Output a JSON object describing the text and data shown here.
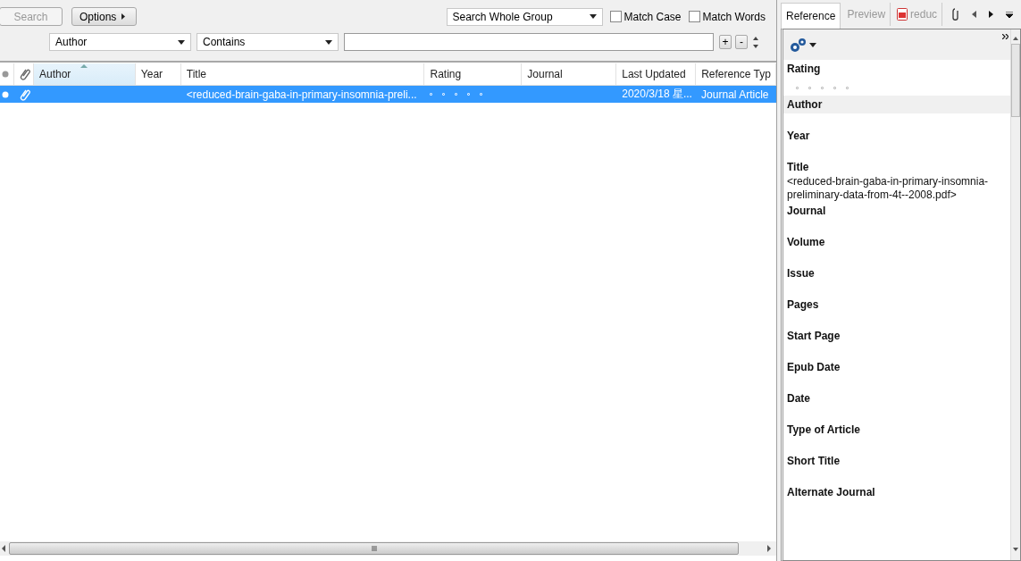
{
  "search_bar": {
    "search_button": {
      "label": "Search",
      "disabled": true
    },
    "options_button": "Options",
    "scope": "Search Whole Group",
    "match_case": {
      "label": "Match Case",
      "checked": false
    },
    "match_words": {
      "label": "Match Words",
      "checked": false
    },
    "criteria": [
      {
        "field": "Author",
        "operator": "Contains"
      }
    ],
    "add_button": "+",
    "remove_button": "-"
  },
  "table": {
    "columns": [
      {
        "label": "Author",
        "sorted": true
      },
      {
        "label": "Year",
        "sorted": false
      },
      {
        "label": "Title",
        "sorted": false
      },
      {
        "label": "Rating",
        "sorted": false
      },
      {
        "label": "Journal",
        "sorted": false
      },
      {
        "label": "Last Updated",
        "sorted": false
      },
      {
        "label": "Reference Typ",
        "sorted": false
      }
    ],
    "rows": [
      {
        "selected": true,
        "attachment": true,
        "title": "<reduced-brain-gaba-in-primary-insomnia-preli...",
        "stars": 0,
        "last_updated": "2020/3/18 星...",
        "reference_type": "Journal Article"
      }
    ]
  },
  "panel": {
    "tabs": [
      {
        "label": "Reference",
        "selected": true,
        "kind": "text"
      },
      {
        "label": "Preview",
        "selected": false,
        "kind": "text"
      },
      {
        "label": "reduc",
        "selected": false,
        "kind": "pdf"
      }
    ],
    "fields": [
      {
        "label": "Rating",
        "kind": "rating",
        "stars": 0,
        "selected": false
      },
      {
        "label": "Author",
        "kind": "text",
        "selected": true
      },
      {
        "label": "Year",
        "kind": "text",
        "selected": false
      },
      {
        "label": "Title",
        "kind": "text",
        "value": "<reduced-brain-gaba-in-primary-insomnia-preliminary-data-from-4t--2008.pdf>",
        "selected": false
      },
      {
        "label": "Journal",
        "kind": "text",
        "selected": false
      },
      {
        "label": "Volume",
        "kind": "text",
        "selected": false
      },
      {
        "label": "Issue",
        "kind": "text",
        "selected": false
      },
      {
        "label": "Pages",
        "kind": "text",
        "selected": false
      },
      {
        "label": "Start Page",
        "kind": "text",
        "selected": false
      },
      {
        "label": "Epub Date",
        "kind": "text",
        "selected": false
      },
      {
        "label": "Date",
        "kind": "text",
        "selected": false
      },
      {
        "label": "Type of Article",
        "kind": "text",
        "selected": false
      },
      {
        "label": "Short Title",
        "kind": "text",
        "selected": false
      },
      {
        "label": "Alternate Journal",
        "kind": "text",
        "selected": false
      }
    ]
  }
}
